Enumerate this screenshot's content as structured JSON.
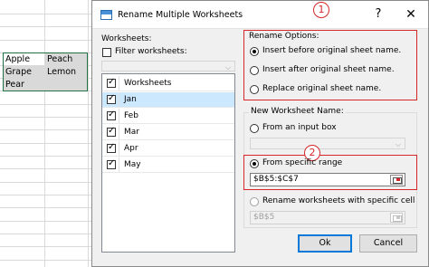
{
  "spreadsheet": {
    "cells": [
      [
        "Apple",
        "Peach"
      ],
      [
        "Grape",
        "Lemon"
      ],
      [
        "Pear",
        ""
      ]
    ]
  },
  "dialog": {
    "title": "Rename Multiple Worksheets",
    "help": "?",
    "close": "✕",
    "worksheets_label": "Worksheets:",
    "filter_label": "Filter worksheets:",
    "list_header": "Worksheets",
    "worksheets": [
      {
        "name": "Jan",
        "checked": true
      },
      {
        "name": "Feb",
        "checked": true
      },
      {
        "name": "Mar",
        "checked": true
      },
      {
        "name": "Apr",
        "checked": true
      },
      {
        "name": "May",
        "checked": true
      }
    ],
    "rename_options": {
      "label": "Rename Options:",
      "options": [
        "Insert before original sheet name.",
        "Insert after original sheet name.",
        "Replace original sheet name."
      ],
      "selected": 0
    },
    "new_name": {
      "label": "New Worksheet Name:",
      "from_input_box": "From an input box",
      "from_specific_range": "From specific range",
      "range_value": "$B$5:$C$7",
      "rename_specific_cell": "Rename worksheets with specific cell",
      "cell_value": "$B$5"
    },
    "badges": [
      "1",
      "2"
    ],
    "buttons": {
      "ok": "Ok",
      "cancel": "Cancel"
    },
    "colors": {
      "highlight_red": "#d62728",
      "selection_blue": "#cce8ff",
      "excel_green": "#217346"
    }
  }
}
